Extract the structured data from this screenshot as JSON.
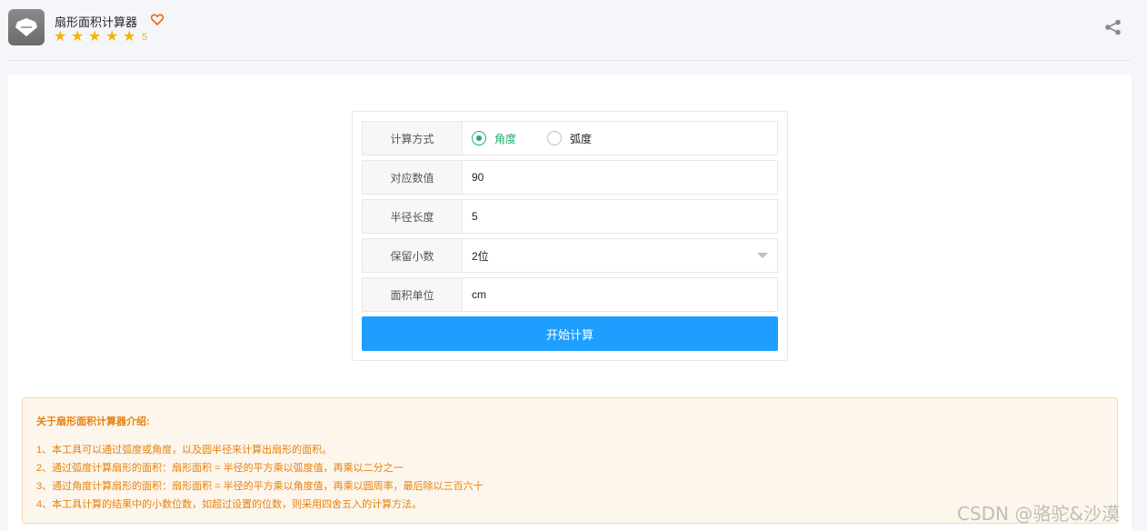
{
  "header": {
    "app_icon": "gem-icon",
    "title": "扇形面积计算器",
    "favorite_icon": "heart-icon",
    "rating": "5",
    "share_icon": "share-icon"
  },
  "form": {
    "method": {
      "label": "计算方式",
      "options": [
        {
          "label": "角度",
          "selected": true
        },
        {
          "label": "弧度",
          "selected": false
        }
      ]
    },
    "value": {
      "label": "对应数值",
      "value": "90"
    },
    "radius": {
      "label": "半径长度",
      "value": "5"
    },
    "decimals": {
      "label": "保留小数",
      "value": "2位"
    },
    "unit": {
      "label": "面积单位",
      "value": "cm"
    },
    "submit_label": "开始计算"
  },
  "intro": {
    "title": "关于扇形面积计算器介绍:",
    "lines": [
      "1、本工具可以通过弧度或角度，以及圆半径来计算出扇形的面积。",
      "2、通过弧度计算扇形的面积：扇形面积 = 半径的平方乘以弧度值，再乘以二分之一",
      "3、通过角度计算扇形的面积：扇形面积 = 半径的平方乘以角度值，再乘以圆周率，最后除以三百六十",
      "4、本工具计算的结果中的小数位数，如超过设置的位数，则采用四舍五入的计算方法。"
    ]
  },
  "watermark": "CSDN @骆驼&沙漠",
  "colors": {
    "accent": "#1e9fff",
    "radio_selected": "#1aad6a",
    "star": "#f5b400",
    "intro_text": "#e6820e",
    "intro_bg": "#fdf6ec"
  }
}
